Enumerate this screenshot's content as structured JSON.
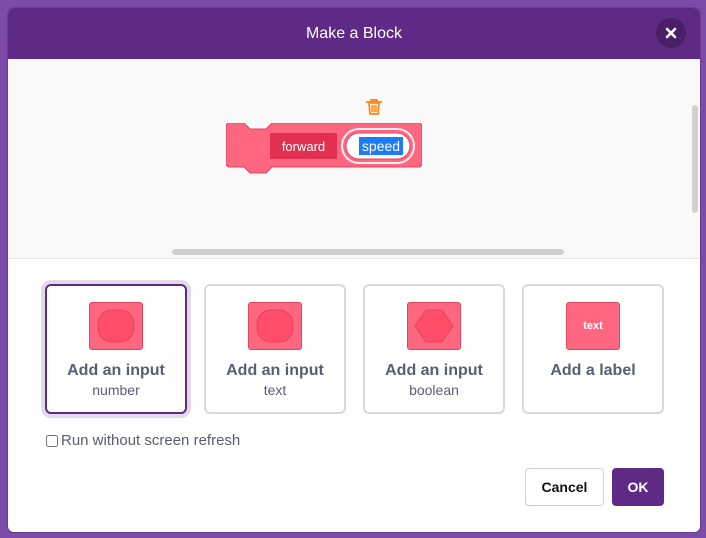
{
  "header": {
    "title": "Make a Block",
    "close_icon": "close-icon"
  },
  "workspace": {
    "block": {
      "label": "forward",
      "input_value": "speed"
    },
    "trash_icon": "trash-icon"
  },
  "options": [
    {
      "title": "Add an input",
      "subtitle": "number",
      "icon": "number-input-icon"
    },
    {
      "title": "Add an input",
      "subtitle": "text",
      "icon": "text-input-icon"
    },
    {
      "title": "Add an input",
      "subtitle": "boolean",
      "icon": "boolean-input-icon"
    },
    {
      "title": "Add a label",
      "icon_text": "text",
      "icon": "label-icon"
    }
  ],
  "refresh": {
    "label": "Run without screen refresh",
    "checked": false
  },
  "buttons": {
    "cancel": "Cancel",
    "ok": "OK"
  },
  "colors": {
    "header": "#5e2a86",
    "block": "#ff6680",
    "block_dark": "#e2455e",
    "text": "#575e75"
  }
}
